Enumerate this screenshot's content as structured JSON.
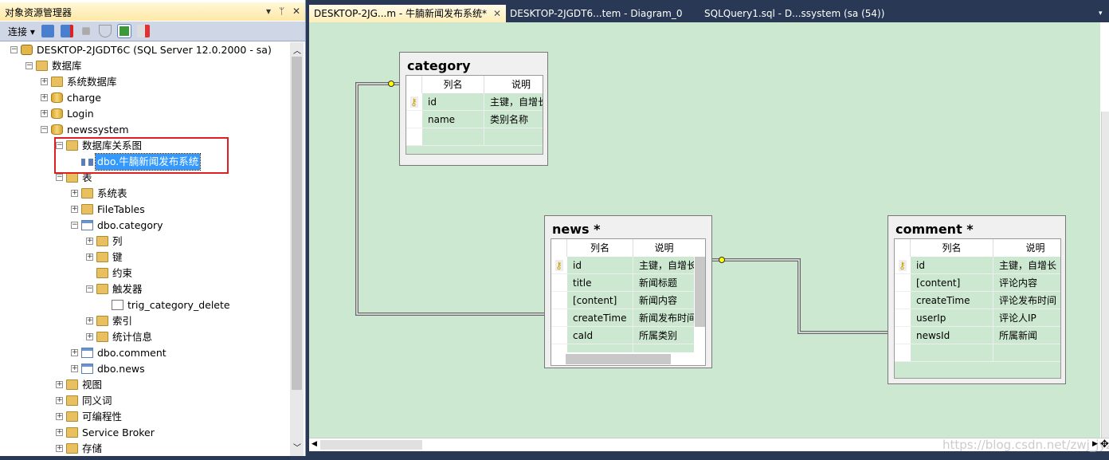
{
  "explorer": {
    "title": "对象资源管理器",
    "controls": [
      "▾",
      "ᛘ",
      "✕"
    ],
    "connect_label": "连接",
    "tree": [
      {
        "level": 0,
        "exp": "-",
        "icon": "server",
        "label": "DESKTOP-2JGDT6C (SQL Server 12.0.2000 - sa)"
      },
      {
        "level": 1,
        "exp": "-",
        "icon": "folder",
        "label": "数据库"
      },
      {
        "level": 2,
        "exp": "+",
        "icon": "folder",
        "label": "系统数据库"
      },
      {
        "level": 2,
        "exp": "+",
        "icon": "db",
        "label": "charge"
      },
      {
        "level": 2,
        "exp": "+",
        "icon": "db",
        "label": "Login"
      },
      {
        "level": 2,
        "exp": "-",
        "icon": "db",
        "label": "newssystem"
      },
      {
        "level": 3,
        "exp": "-",
        "icon": "folder",
        "label": "数据库关系图"
      },
      {
        "level": 4,
        "exp": "",
        "icon": "diagram",
        "label": "dbo.牛腩新闻发布系统",
        "selected": true
      },
      {
        "level": 3,
        "exp": "-",
        "icon": "folder",
        "label": "表"
      },
      {
        "level": 4,
        "exp": "+",
        "icon": "folder",
        "label": "系统表"
      },
      {
        "level": 4,
        "exp": "+",
        "icon": "folder",
        "label": "FileTables"
      },
      {
        "level": 4,
        "exp": "-",
        "icon": "table",
        "label": "dbo.category"
      },
      {
        "level": 5,
        "exp": "+",
        "icon": "folder",
        "label": "列"
      },
      {
        "level": 5,
        "exp": "+",
        "icon": "folder",
        "label": "键"
      },
      {
        "level": 5,
        "exp": "",
        "icon": "folder",
        "label": "约束"
      },
      {
        "level": 5,
        "exp": "-",
        "icon": "folder",
        "label": "触发器"
      },
      {
        "level": 6,
        "exp": "",
        "icon": "trigger",
        "label": "trig_category_delete"
      },
      {
        "level": 5,
        "exp": "+",
        "icon": "folder",
        "label": "索引"
      },
      {
        "level": 5,
        "exp": "+",
        "icon": "folder",
        "label": "统计信息"
      },
      {
        "level": 4,
        "exp": "+",
        "icon": "table",
        "label": "dbo.comment"
      },
      {
        "level": 4,
        "exp": "+",
        "icon": "table",
        "label": "dbo.news"
      },
      {
        "level": 3,
        "exp": "+",
        "icon": "folder",
        "label": "视图"
      },
      {
        "level": 3,
        "exp": "+",
        "icon": "folder",
        "label": "同义词"
      },
      {
        "level": 3,
        "exp": "+",
        "icon": "folder",
        "label": "可编程性"
      },
      {
        "level": 3,
        "exp": "+",
        "icon": "folder",
        "label": "Service Broker"
      },
      {
        "level": 3,
        "exp": "+",
        "icon": "folder",
        "label": "存储"
      }
    ]
  },
  "tabs": [
    {
      "label": "DESKTOP-2JG...m - 牛腩新闻发布系统*",
      "active": true,
      "close": "✕"
    },
    {
      "label": "DESKTOP-2JGDT6...tem - Diagram_0"
    },
    {
      "label": "SQLQuery1.sql - D...ssystem (sa (54))"
    }
  ],
  "diagram": {
    "headers": [
      "列名",
      "说明"
    ],
    "tables": [
      {
        "name": "category",
        "rows": [
          [
            "id",
            "主键，自增长",
            true
          ],
          [
            "name",
            "类别名称"
          ],
          [
            "",
            ""
          ]
        ]
      },
      {
        "name": "news *",
        "rows": [
          [
            "id",
            "主键，自增长",
            true
          ],
          [
            "title",
            "新闻标题"
          ],
          [
            "[content]",
            "新闻内容"
          ],
          [
            "createTime",
            "新闻发布时间"
          ],
          [
            "caId",
            "所属类别"
          ],
          [
            "",
            ""
          ]
        ]
      },
      {
        "name": "comment *",
        "rows": [
          [
            "id",
            "主键，自增长",
            true
          ],
          [
            "[content]",
            "评论内容"
          ],
          [
            "createTime",
            "评论发布时间"
          ],
          [
            "userIp",
            "评论人IP"
          ],
          [
            "newsId",
            "所属新闻"
          ],
          [
            "",
            ""
          ]
        ]
      }
    ]
  },
  "watermark": "https://blog.csdn.net/zwj_jyz",
  "colors": {
    "canvas": "#cde8d0",
    "selection": "#3399ff",
    "highlight": "#e02020"
  }
}
